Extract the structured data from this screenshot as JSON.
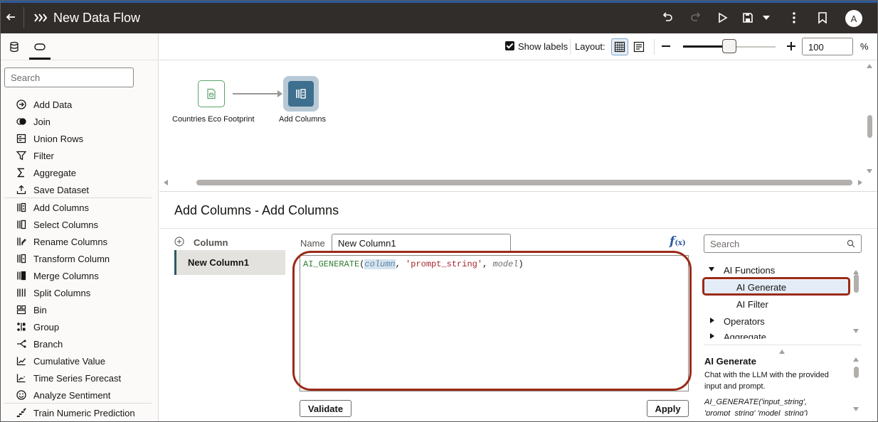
{
  "app": {
    "title": "New Data Flow",
    "avatar_initial": "A",
    "accent_color": "#2b5aa0",
    "header_bg": "#312d2a"
  },
  "header_icons": [
    "back-arrow-icon",
    "data-flow-icon",
    "undo-icon",
    "redo-icon",
    "run-icon",
    "save-icon",
    "chevron-down-icon",
    "kebab-menu-icon",
    "bookmark-icon"
  ],
  "left_panel": {
    "tabs": [
      "data-tab",
      "steps-tab"
    ],
    "search_placeholder": "Search",
    "steps": [
      {
        "label": "Add Data",
        "icon": "add-data-icon"
      },
      {
        "label": "Join",
        "icon": "join-icon"
      },
      {
        "label": "Union Rows",
        "icon": "union-rows-icon"
      },
      {
        "label": "Filter",
        "icon": "filter-icon"
      },
      {
        "label": "Aggregate",
        "icon": "aggregate-icon"
      },
      {
        "label": "Save Dataset",
        "icon": "save-dataset-icon"
      },
      {
        "label": "Add Columns",
        "icon": "add-columns-icon"
      },
      {
        "label": "Select Columns",
        "icon": "select-columns-icon"
      },
      {
        "label": "Rename Columns",
        "icon": "rename-columns-icon"
      },
      {
        "label": "Transform Column",
        "icon": "transform-column-icon"
      },
      {
        "label": "Merge Columns",
        "icon": "merge-columns-icon"
      },
      {
        "label": "Split Columns",
        "icon": "split-columns-icon"
      },
      {
        "label": "Bin",
        "icon": "bin-icon"
      },
      {
        "label": "Group",
        "icon": "group-icon"
      },
      {
        "label": "Branch",
        "icon": "branch-icon"
      },
      {
        "label": "Cumulative Value",
        "icon": "cumulative-value-icon"
      },
      {
        "label": "Time Series Forecast",
        "icon": "time-series-forecast-icon"
      },
      {
        "label": "Analyze Sentiment",
        "icon": "analyze-sentiment-icon"
      },
      {
        "label": "Train Numeric Prediction",
        "icon": "train-numeric-prediction-icon"
      }
    ]
  },
  "toolbar": {
    "show_labels": "Show labels",
    "show_labels_checked": true,
    "layout_label": "Layout:",
    "zoom_value": "100",
    "zoom_unit": "%",
    "zoom_slider_level": 0.5
  },
  "canvas": {
    "nodes": [
      {
        "label": "Countries Eco Footprint",
        "icon": "dataset-icon",
        "border_color": "#5aa56a"
      },
      {
        "label": "Add Columns",
        "icon": "add-columns-icon",
        "selected": true
      }
    ]
  },
  "step_editor": {
    "title": "Add Columns - Add Columns",
    "add_column_label": "Column",
    "columns": [
      "New Column1"
    ],
    "name_label": "Name",
    "name_value": "New Column1",
    "fx_label": "f",
    "fx_sub": "(x)",
    "expression": {
      "fn": "AI_GENERATE",
      "open": "(",
      "arg1": "column",
      "sep1": ", ",
      "arg2": "'prompt_string'",
      "sep2": ", ",
      "arg3": "model",
      "close": ")"
    },
    "validate_label": "Validate",
    "apply_label": "Apply",
    "highlight_color": "#9b2a17"
  },
  "function_browser": {
    "search_placeholder": "Search",
    "tree": {
      "ai_functions": "AI Functions",
      "ai_generate": "AI Generate",
      "ai_filter": "AI Filter",
      "operators": "Operators",
      "next_partial": "Aggregate"
    },
    "help": {
      "title": "AI Generate",
      "description": "Chat with the LLM with the provided input and prompt.",
      "signature": "AI_GENERATE('input_string', 'prompt_string' 'model_string')"
    }
  }
}
